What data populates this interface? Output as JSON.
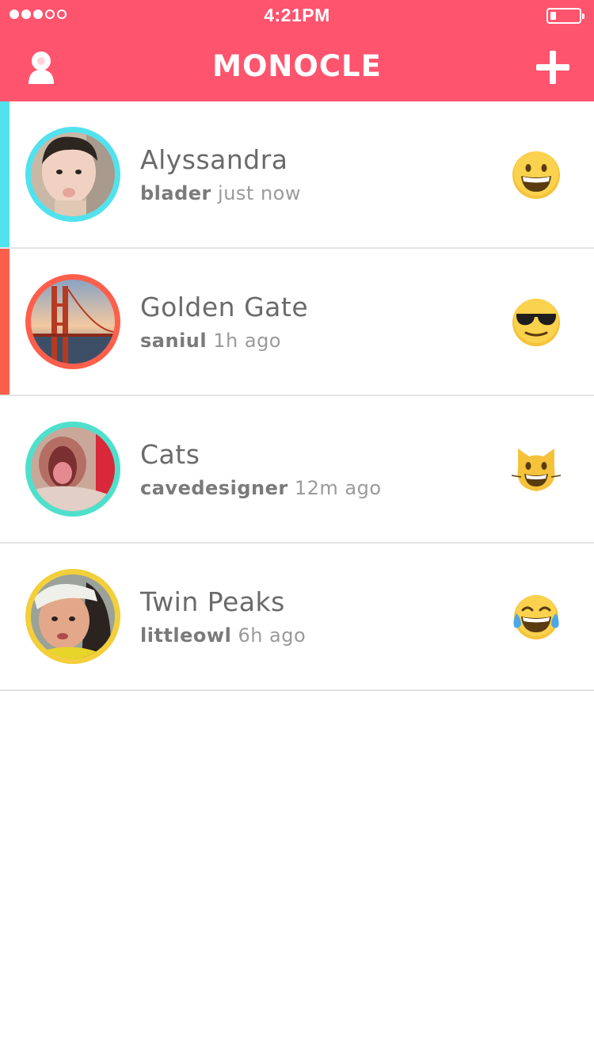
{
  "status_bar": {
    "time": "4:21PM",
    "signal_dots_filled": 3,
    "signal_dots_total": 5
  },
  "header": {
    "title": "MONOCLE",
    "background_color": "#fe546e",
    "left_icon": "profile-icon",
    "right_icon": "plus-icon"
  },
  "feed": [
    {
      "name": "Alyssandra",
      "user": "blader",
      "time": "just now",
      "ring_color": "#52e2ee",
      "accent_color": "#52e2ee",
      "emoji": "grinning-face-icon"
    },
    {
      "name": "Golden Gate",
      "user": "saniul",
      "time": "1h ago",
      "ring_color": "#fd5f4c",
      "accent_color": "#fd5f4c",
      "emoji": "sunglasses-face-icon"
    },
    {
      "name": "Cats",
      "user": "cavedesigner",
      "time": "12m ago",
      "ring_color": "#4fe0cc",
      "accent_color": "",
      "emoji": "grinning-cat-icon"
    },
    {
      "name": "Twin Peaks",
      "user": "littleowl",
      "time": "6h ago",
      "ring_color": "#f2cf3b",
      "accent_color": "",
      "emoji": "tears-of-joy-icon"
    }
  ]
}
